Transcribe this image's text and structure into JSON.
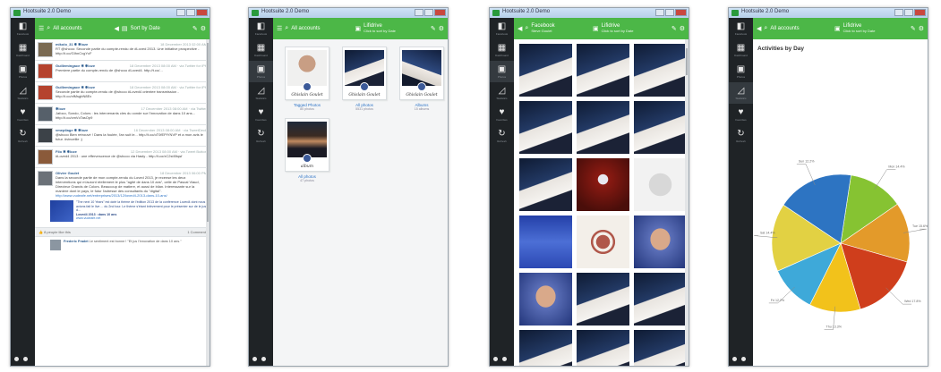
{
  "app": {
    "title": "Hootsuite 2.0 Demo"
  },
  "sidebar": [
    {
      "icon": "facebook-icon",
      "label": "Facebook"
    },
    {
      "icon": "dashboard-icon",
      "label": "Dashboard"
    },
    {
      "icon": "photos-icon",
      "label": "Photos"
    },
    {
      "icon": "stats-icon",
      "label": "Statistics"
    },
    {
      "icon": "heart-icon",
      "label": "Favorites"
    },
    {
      "icon": "refresh-icon",
      "label": "Refresh"
    }
  ],
  "windows": [
    {
      "top": {
        "account": "All accounts",
        "mid": "Sort by Date",
        "mid_sub": ""
      }
    },
    {
      "top": {
        "account": "All accounts",
        "mid": "Lifidrive",
        "mid_sub": "Click to sort by Date"
      }
    },
    {
      "top": {
        "account": "Facebook",
        "account_sub": "Steve Goulet",
        "mid": "Lifidrive",
        "mid_sub": "Click to sort by Date"
      }
    },
    {
      "top": {
        "account": "All accounts",
        "mid": "Lifidrive",
        "mid_sub": "Click to sort by Date"
      }
    }
  ],
  "feed": {
    "posts": [
      {
        "author": "mikolo_31 ✱ ✱loze",
        "date": "18 December 2013 02:00 AM",
        "text": "RT @shcoo: Seconde partie du compte-rendu de #Loved 2013. Une initiative prospective - http://t.co/GIhnCvgYcF",
        "avatar": "#7a6a52"
      },
      {
        "author": "Guillemingace ✱ ✱loze",
        "date": "18 December 2013 08:00 AM · via Twitter for iPh",
        "text": "Premiere partie du compte-rendu de @shcoo #Loved4. http://t.co/...",
        "avatar": "#b5432e"
      },
      {
        "author": "Guillemingace ✱ ✱loze",
        "date": "18 December 2013 08:00 AM · via Twitter for iPh",
        "text": "Seconde partie du compte-rendu de @shcoo #Loved4 orientee transmission - http://t.co/xfMsgbN8Ex",
        "avatar": "#b5432e"
      },
      {
        "author": "✱loze",
        "date": "17 December 2013 08:00 AM · via Twitter",
        "text": "Jafoco, Sondo, Colors : les intervenants cles du conde sur l'innovation de dans 10 ans... http://t.co/cmVcTasOp9",
        "avatar": "#56606a"
      },
      {
        "author": "vmepilage ✱ ✱loze",
        "date": "16 December 2013 08:00 AM · via TweetDeck",
        "text": "@shcoo Bien retrouvé ! Dans la foulée, l'an suit le... http://t.co/oT0fEPIYNVP et a mon avis le futur. #vinceilie ;)",
        "avatar": "#3c4248"
      },
      {
        "author": "Filo ✱ ✱loze",
        "date": "12 December 2013 08:00 AM · via Tweet Button",
        "text": "#Loved4 2013 : une effervescence de @shcoo via Hasty - http://t.co/xC2stI0tqsf",
        "avatar": "#8a5a3a"
      }
    ],
    "big_post": {
      "author": "Olivier Goulet",
      "date": "18 December 2013 06:00 PM",
      "text": "Dans la seconde partie de mon compte-rendu du Loved 2013, je recense les deux interventions qui m'auront réellement le plus \"agité de dans 10 ans\", celle de Pascal Viaud, Directeur Grands de Colors. Beaucoup de matiere, et aussi de bilan. Interessante sur la maniere dont le pays, le futur l'adresse des consultants du \"digital\".",
      "link": "http://www.vudeafe.net/entreprises/2013/12/loved4-2013-dans-10-ans/",
      "embed_title": "\"The next 10 Years\" est doté la thème de l'édition 2013 de la conférence Loved4 dont nous avions fait le live ... du 2nd tour. Le thème s'étant brièvement pour le présenter sur de le jus d...",
      "embed_name": "Loved4 2013 : dans 10 ans",
      "embed_site": "www.vudeafe.net",
      "likes": "8 people like this",
      "comments": "1 Comment",
      "comment_author": "Frederic Fradet",
      "comment_text": "Le sentiment est bonne ! \"Et jus l'innovation de dans 10 ans.\""
    }
  },
  "albums": [
    {
      "name": "Tagged Photos",
      "count": "80 photos",
      "sig": "Ghislain Goulet",
      "img": "portrait"
    },
    {
      "name": "All photos",
      "count": "5531 photos",
      "sig": "Ghislain Goulet",
      "img": "stage"
    },
    {
      "name": "Albums",
      "count": "15 albums",
      "sig": "Ghislain Goulet",
      "img": "stage2"
    },
    {
      "name": "All photos",
      "count": "47 photos",
      "sig": "album",
      "img": "woman"
    }
  ],
  "photos": [
    "stage",
    "stage",
    "stage",
    "stage",
    "stage",
    "stage",
    "stage",
    "red",
    "white",
    "blue",
    "heart",
    "shirtless",
    "shirtless",
    "stage",
    "stage",
    "stage",
    "stage",
    "stage"
  ],
  "chart_data": {
    "type": "pie",
    "title": "Activities by Day",
    "labels": [
      "Mon",
      "Tue",
      "Wed",
      "Thu",
      "Fri",
      "Sat",
      "Sun"
    ],
    "values": [
      13,
      14,
      16,
      12,
      11,
      16,
      18
    ],
    "colors": [
      "#86c332",
      "#e39a2a",
      "#cf3e1c",
      "#f2c21b",
      "#3ea9d9",
      "#e2d143",
      "#2d74c2"
    ],
    "slice_labels": [
      "Mon 14.4%",
      "Tue 15.6%",
      "Wed 17.8%",
      "Thu 13.3%",
      "Fri 12.2%",
      "Sat 14.4%",
      "Sun 12.2%"
    ]
  }
}
